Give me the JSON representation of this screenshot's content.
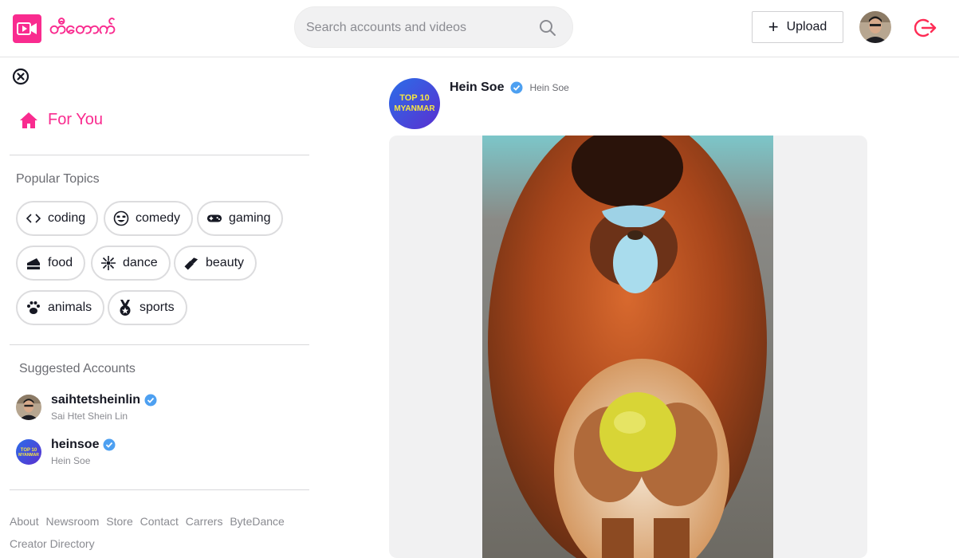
{
  "app": {
    "logo_text": "တီတောက်",
    "brand_color": "#f92b8f"
  },
  "header": {
    "search_placeholder": "Search accounts and videos",
    "upload_label": "Upload",
    "icons": [
      "search-icon",
      "plus-icon",
      "logout-icon"
    ]
  },
  "sidebar": {
    "for_you_label": "For You",
    "popular_topics_title": "Popular Topics",
    "topics": [
      {
        "label": "coding",
        "icon": "code-icon"
      },
      {
        "label": "comedy",
        "icon": "laughing-face-icon"
      },
      {
        "label": "gaming",
        "icon": "gamepad-icon"
      },
      {
        "label": "food",
        "icon": "cake-icon"
      },
      {
        "label": "dance",
        "icon": "dance-icon"
      },
      {
        "label": "beauty",
        "icon": "lipstick-icon"
      },
      {
        "label": "animals",
        "icon": "paw-icon"
      },
      {
        "label": "sports",
        "icon": "medal-icon"
      }
    ],
    "suggested_title": "Suggested Accounts",
    "accounts": [
      {
        "username": "saihtetsheinlin",
        "display_name": "Sai Htet Shein Lin",
        "verified": true
      },
      {
        "username": "heinsoe",
        "display_name": "Hein Soe",
        "verified": true
      }
    ],
    "footer_links": [
      "About",
      "Newsroom",
      "Store",
      "Contact",
      "Carrers",
      "ByteDance",
      "Creator Directory"
    ]
  },
  "post": {
    "author_name": "Hein Soe",
    "author_nickname": "Hein Soe",
    "verified": true,
    "avatar_text_line1": "TOP 10",
    "avatar_text_line2": "MYANMAR"
  },
  "colors": {
    "accent": "#f92b8f",
    "verified": "#20d5ec",
    "logout": "#fe2c55"
  }
}
